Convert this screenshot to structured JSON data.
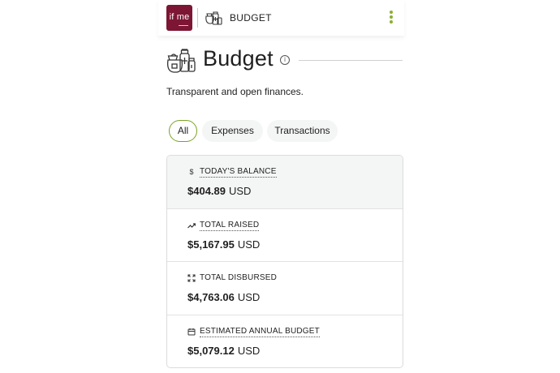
{
  "topbar": {
    "logo_text": "if me",
    "section_title": "BUDGET",
    "accent_color": "#7d1534",
    "menu_color": "#8ab02d"
  },
  "header": {
    "title": "Budget",
    "info_glyph": "i",
    "subtitle": "Transparent and open finances."
  },
  "tabs": [
    {
      "label": "All",
      "active": true
    },
    {
      "label": "Expenses",
      "active": false
    },
    {
      "label": "Transactions",
      "active": false
    }
  ],
  "stats": [
    {
      "icon": "dollar-icon",
      "label": "TODAY'S BALANCE",
      "amount": "$404.89",
      "currency": "USD"
    },
    {
      "icon": "trend-up-icon",
      "label": "TOTAL RAISED",
      "amount": "$5,167.95",
      "currency": "USD"
    },
    {
      "icon": "expand-icon",
      "label": "TOTAL DISBURSED",
      "amount": "$4,763.06",
      "currency": "USD"
    },
    {
      "icon": "calendar-icon",
      "label": "ESTIMATED ANNUAL BUDGET",
      "amount": "$5,079.12",
      "currency": "USD"
    }
  ]
}
